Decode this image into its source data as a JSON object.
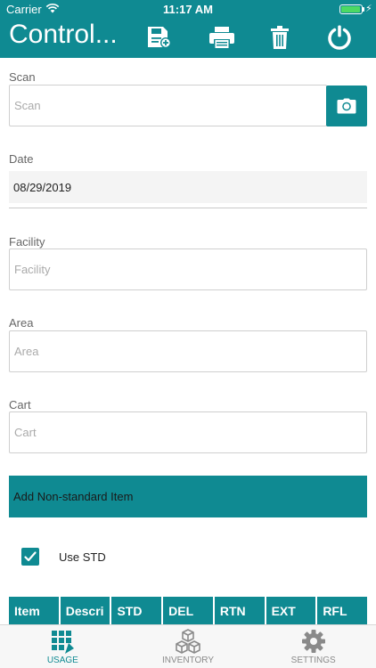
{
  "status_bar": {
    "carrier": "Carrier",
    "time": "11:17 AM",
    "battery_level": 0.95
  },
  "nav": {
    "title": "Control...",
    "actions": [
      "save-icon",
      "print-icon",
      "trash-icon",
      "power-icon"
    ]
  },
  "form": {
    "scan": {
      "label": "Scan",
      "placeholder": "Scan",
      "value": ""
    },
    "date": {
      "label": "Date",
      "value": "08/29/2019"
    },
    "facility": {
      "label": "Facility",
      "placeholder": "Facility",
      "value": ""
    },
    "area": {
      "label": "Area",
      "placeholder": "Area",
      "value": ""
    },
    "cart": {
      "label": "Cart",
      "placeholder": "Cart",
      "value": ""
    },
    "add_button_label": "Add Non-standard Item",
    "use_std": {
      "label": "Use STD",
      "checked": true
    }
  },
  "table": {
    "columns": [
      "Item",
      "Descri",
      "STD",
      "DEL",
      "RTN",
      "EXT",
      "RFL"
    ]
  },
  "tab_bar": {
    "tabs": [
      {
        "label": "USAGE",
        "icon": "usage-icon",
        "active": true
      },
      {
        "label": "INVENTORY",
        "icon": "inventory-icon",
        "active": false
      },
      {
        "label": "SETTINGS",
        "icon": "gear-icon",
        "active": false
      }
    ]
  },
  "colors": {
    "accent": "#0f8a92",
    "tab_inactive": "#8a8a8a"
  }
}
